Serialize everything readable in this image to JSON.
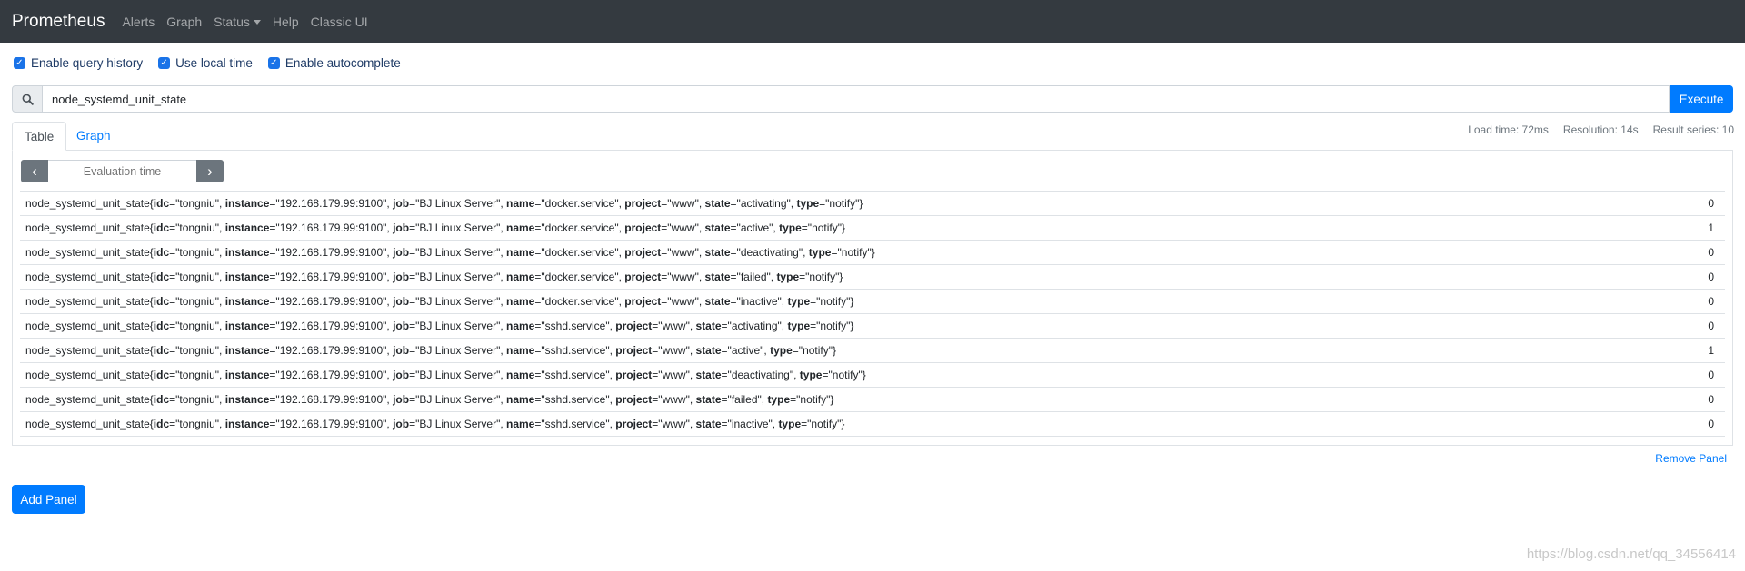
{
  "nav": {
    "brand": "Prometheus",
    "links": [
      "Alerts",
      "Graph",
      "Status",
      "Help",
      "Classic UI"
    ]
  },
  "options": {
    "query_history": "Enable query history",
    "local_time": "Use local time",
    "autocomplete": "Enable autocomplete"
  },
  "query": {
    "value": "node_systemd_unit_state",
    "execute_label": "Execute"
  },
  "tabs": {
    "table": "Table",
    "graph": "Graph"
  },
  "stats": {
    "load_time": "Load time: 72ms",
    "resolution": "Resolution: 14s",
    "result_series": "Result series: 10"
  },
  "eval": {
    "placeholder": "Evaluation time"
  },
  "metric_name": "node_systemd_unit_state",
  "rows": [
    {
      "idc": "tongniu",
      "instance": "192.168.179.99:9100",
      "job": "BJ Linux Server",
      "name": "docker.service",
      "project": "www",
      "state": "activating",
      "type": "notify",
      "value": "0"
    },
    {
      "idc": "tongniu",
      "instance": "192.168.179.99:9100",
      "job": "BJ Linux Server",
      "name": "docker.service",
      "project": "www",
      "state": "active",
      "type": "notify",
      "value": "1"
    },
    {
      "idc": "tongniu",
      "instance": "192.168.179.99:9100",
      "job": "BJ Linux Server",
      "name": "docker.service",
      "project": "www",
      "state": "deactivating",
      "type": "notify",
      "value": "0"
    },
    {
      "idc": "tongniu",
      "instance": "192.168.179.99:9100",
      "job": "BJ Linux Server",
      "name": "docker.service",
      "project": "www",
      "state": "failed",
      "type": "notify",
      "value": "0"
    },
    {
      "idc": "tongniu",
      "instance": "192.168.179.99:9100",
      "job": "BJ Linux Server",
      "name": "docker.service",
      "project": "www",
      "state": "inactive",
      "type": "notify",
      "value": "0"
    },
    {
      "idc": "tongniu",
      "instance": "192.168.179.99:9100",
      "job": "BJ Linux Server",
      "name": "sshd.service",
      "project": "www",
      "state": "activating",
      "type": "notify",
      "value": "0"
    },
    {
      "idc": "tongniu",
      "instance": "192.168.179.99:9100",
      "job": "BJ Linux Server",
      "name": "sshd.service",
      "project": "www",
      "state": "active",
      "type": "notify",
      "value": "1"
    },
    {
      "idc": "tongniu",
      "instance": "192.168.179.99:9100",
      "job": "BJ Linux Server",
      "name": "sshd.service",
      "project": "www",
      "state": "deactivating",
      "type": "notify",
      "value": "0"
    },
    {
      "idc": "tongniu",
      "instance": "192.168.179.99:9100",
      "job": "BJ Linux Server",
      "name": "sshd.service",
      "project": "www",
      "state": "failed",
      "type": "notify",
      "value": "0"
    },
    {
      "idc": "tongniu",
      "instance": "192.168.179.99:9100",
      "job": "BJ Linux Server",
      "name": "sshd.service",
      "project": "www",
      "state": "inactive",
      "type": "notify",
      "value": "0"
    }
  ],
  "remove_panel": "Remove Panel",
  "add_panel": "Add Panel",
  "watermark": "https://blog.csdn.net/qq_34556414"
}
